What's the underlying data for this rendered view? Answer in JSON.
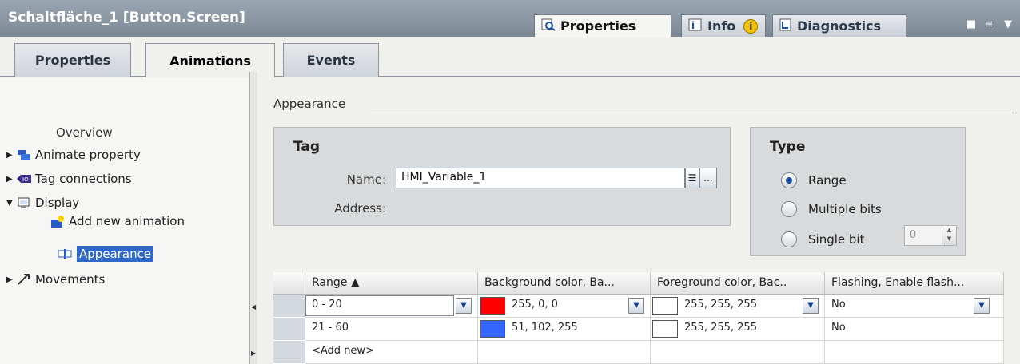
{
  "window": {
    "title": "Schaltfläche_1 [Button.Screen]",
    "tabs": [
      {
        "label": "Properties",
        "icon": "magnifier-properties-icon",
        "active": true
      },
      {
        "label": "Info",
        "icon": "info-icon",
        "badge": "i"
      },
      {
        "label": "Diagnostics",
        "icon": "diagnostics-icon"
      }
    ]
  },
  "subtabs": [
    {
      "label": "Properties",
      "active": false
    },
    {
      "label": "Animations",
      "active": true
    },
    {
      "label": "Events",
      "active": false
    }
  ],
  "tree": {
    "overview": "Overview",
    "items": [
      {
        "label": "Animate property",
        "icon": "animate-property-icon",
        "expanded": false
      },
      {
        "label": "Tag connections",
        "icon": "tag-connections-icon",
        "expanded": false
      },
      {
        "label": "Display",
        "icon": "display-icon",
        "expanded": true
      },
      {
        "label": "Add new animation",
        "icon": "add-animation-icon"
      },
      {
        "label": "Appearance",
        "icon": "appearance-icon",
        "selected": true
      },
      {
        "label": "Movements",
        "icon": "movements-icon",
        "expanded": false
      }
    ]
  },
  "appearance": {
    "section_title": "Appearance",
    "tag_group": {
      "title": "Tag",
      "name_label": "Name:",
      "name_value": "HMI_Variable_1",
      "address_label": "Address:",
      "browse_button": "..."
    },
    "type_group": {
      "title": "Type",
      "options": [
        {
          "label": "Range",
          "selected": true
        },
        {
          "label": "Multiple bits",
          "selected": false
        },
        {
          "label": "Single bit",
          "selected": false
        }
      ],
      "single_bit_value": "0"
    },
    "table": {
      "headers": [
        "Range ▲",
        "Background color, Ba...",
        "Foreground color, Bac..",
        "Flashing, Enable flash..."
      ],
      "rows": [
        {
          "range": "0 - 20",
          "bg_text": "255, 0, 0",
          "bg_color": "#ff0000",
          "fg_text": "255, 255, 255",
          "fg_color": "#ffffff",
          "flashing": "No"
        },
        {
          "range": "21 - 60",
          "bg_text": "51, 102, 255",
          "bg_color": "#3366ff",
          "fg_text": "255, 255, 255",
          "fg_color": "#ffffff",
          "flashing": "No"
        }
      ],
      "add_new": "<Add new>"
    }
  }
}
